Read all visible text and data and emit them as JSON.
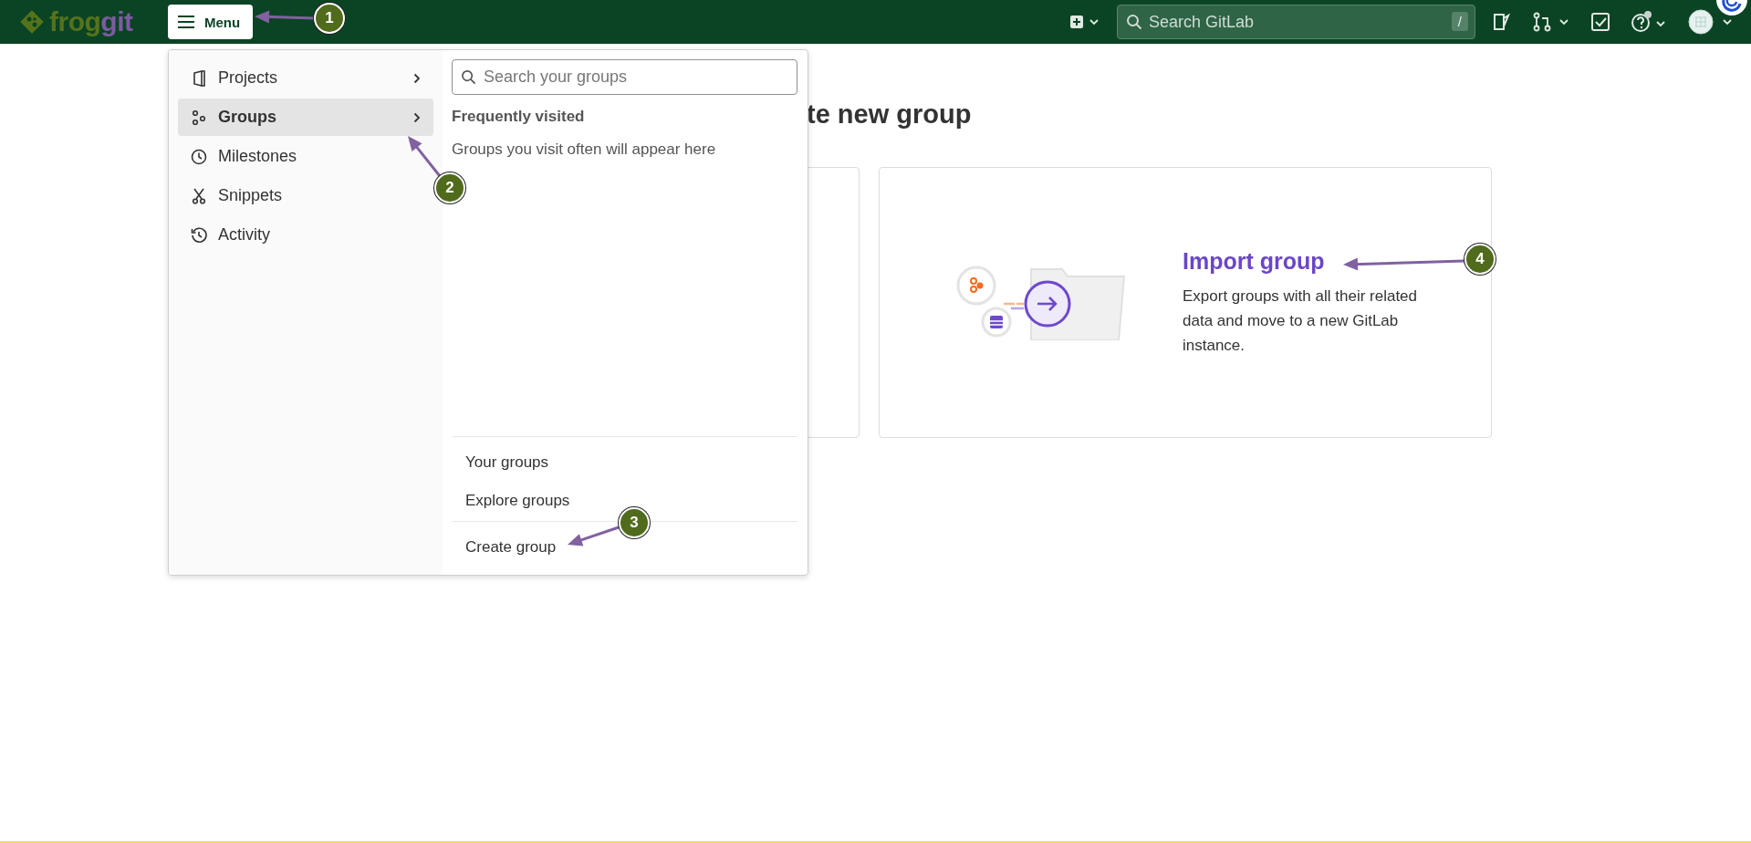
{
  "top_bar": {
    "logo": [
      {
        "text": "frog",
        "color": "#56731c"
      },
      {
        "text": "git",
        "color": "#7b5b9f"
      }
    ],
    "menu_button": {
      "label": "Menu"
    },
    "search": {
      "placeholder": "Search GitLab",
      "shortcut": "/"
    },
    "help_has_notification": true
  },
  "menu": {
    "items": [
      {
        "label": "Projects",
        "selected": false,
        "has_submenu": true
      },
      {
        "label": "Groups",
        "selected": true,
        "has_submenu": true
      },
      {
        "label": "Milestones",
        "selected": false,
        "has_submenu": false
      },
      {
        "label": "Snippets",
        "selected": false,
        "has_submenu": false
      },
      {
        "label": "Activity",
        "selected": false,
        "has_submenu": false
      }
    ],
    "search": {
      "placeholder": "Search your groups"
    },
    "section_title": "Frequently visited",
    "empty_text": "Groups you visit often will appear here",
    "links": [
      "Your groups",
      "Explore groups"
    ],
    "create_link": "Create group"
  },
  "page": {
    "heading": "te new group",
    "import_card": {
      "title": "Import group",
      "description": "Export groups with all their related data and move to a new GitLab instance."
    }
  },
  "annotations": [
    {
      "label": "1"
    },
    {
      "label": "2"
    },
    {
      "label": "3"
    },
    {
      "label": "4"
    }
  ]
}
